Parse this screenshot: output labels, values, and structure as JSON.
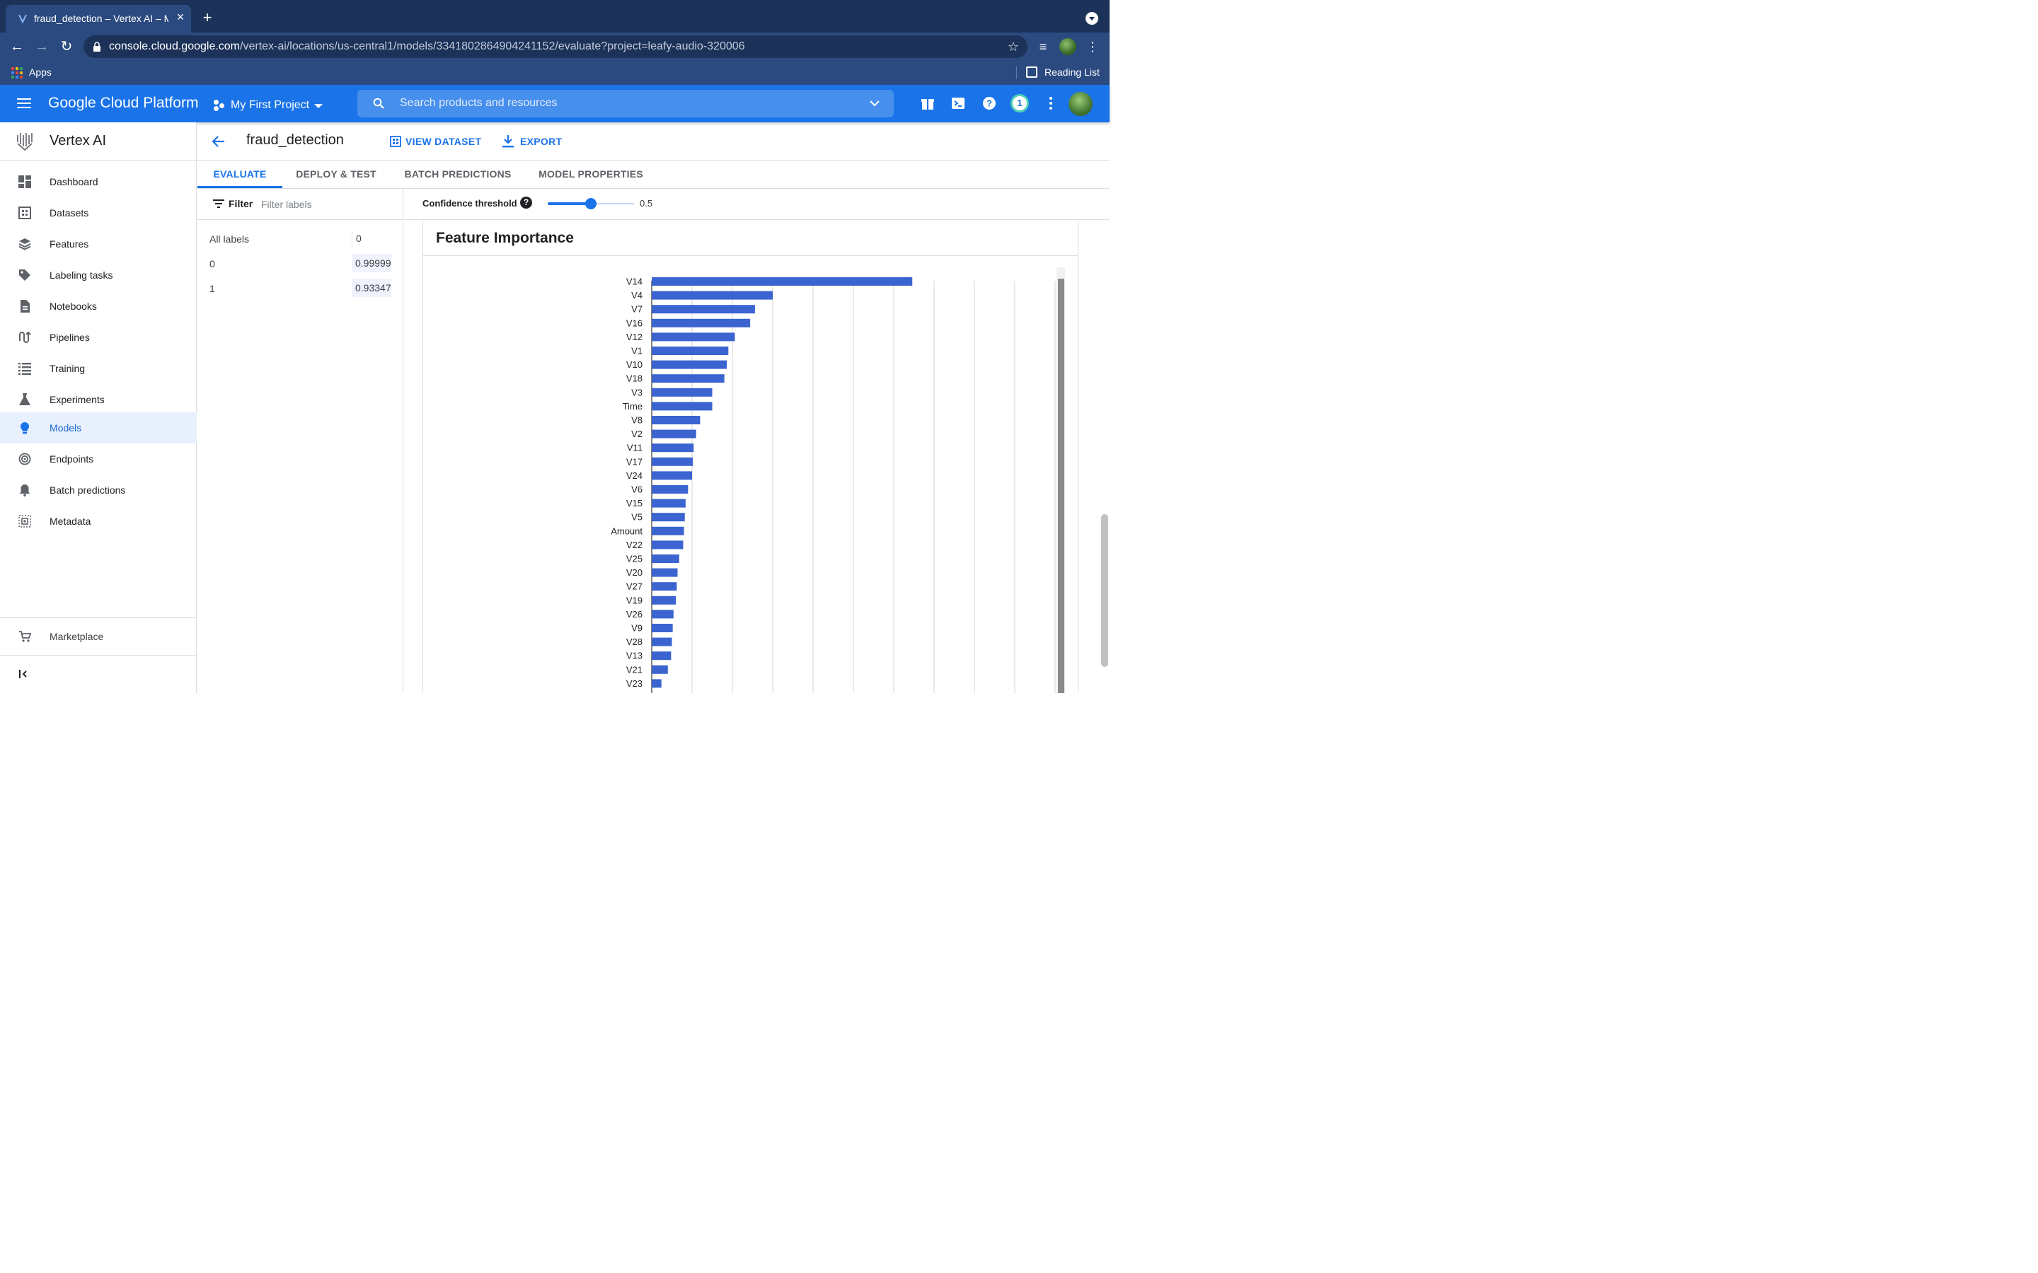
{
  "browser": {
    "tab_title": "fraud_detection – Vertex AI – M",
    "url_host": "console.cloud.google.com",
    "url_path": "/vertex-ai/locations/us-central1/models/3341802864904241152/evaluate?project=leafy-audio-320006",
    "bookmark_apps": "Apps",
    "reading_list": "Reading List"
  },
  "gcp": {
    "title": "Google Cloud Platform",
    "project": "My First Project",
    "search_placeholder": "Search products and resources",
    "notification_count": "1"
  },
  "sidebar": {
    "product": "Vertex AI",
    "items": [
      {
        "label": "Dashboard",
        "icon": "dashboard-icon"
      },
      {
        "label": "Datasets",
        "icon": "datasets-icon"
      },
      {
        "label": "Features",
        "icon": "features-icon"
      },
      {
        "label": "Labeling tasks",
        "icon": "labeling-tag-icon"
      },
      {
        "label": "Notebooks",
        "icon": "notebook-icon"
      },
      {
        "label": "Pipelines",
        "icon": "pipelines-icon"
      },
      {
        "label": "Training",
        "icon": "training-list-icon"
      },
      {
        "label": "Experiments",
        "icon": "flask-icon"
      },
      {
        "label": "Models",
        "icon": "lightbulb-icon",
        "active": true
      },
      {
        "label": "Endpoints",
        "icon": "endpoints-icon"
      },
      {
        "label": "Batch predictions",
        "icon": "bell-icon"
      },
      {
        "label": "Metadata",
        "icon": "metadata-icon"
      }
    ],
    "marketplace": "Marketplace"
  },
  "content": {
    "title": "fraud_detection",
    "view_dataset": "VIEW DATASET",
    "export": "EXPORT",
    "tabs": [
      "EVALUATE",
      "DEPLOY & TEST",
      "BATCH PREDICTIONS",
      "MODEL PROPERTIES"
    ],
    "active_tab": "EVALUATE"
  },
  "filter": {
    "label": "Filter",
    "placeholder": "Filter labels",
    "rows": [
      {
        "name": "All labels",
        "value": "0"
      },
      {
        "name": "0",
        "value": "0.99999"
      },
      {
        "name": "1",
        "value": "0.93347"
      }
    ]
  },
  "threshold": {
    "label": "Confidence threshold",
    "help": "?",
    "value": "0.5",
    "fraction": 0.5
  },
  "chart_data": {
    "type": "bar",
    "orientation": "horizontal",
    "title": "Feature Importance",
    "color": "#3b64d0",
    "categories": [
      "V14",
      "V4",
      "V7",
      "V16",
      "V12",
      "V1",
      "V10",
      "V18",
      "V3",
      "Time",
      "V8",
      "V2",
      "V11",
      "V17",
      "V24",
      "V6",
      "V15",
      "V5",
      "Amount",
      "V22",
      "V25",
      "V20",
      "V27",
      "V19",
      "V26",
      "V9",
      "V28",
      "V13",
      "V21",
      "V23"
    ],
    "values": [
      0.323,
      0.15,
      0.128,
      0.122,
      0.103,
      0.095,
      0.093,
      0.09,
      0.075,
      0.075,
      0.06,
      0.055,
      0.052,
      0.051,
      0.05,
      0.045,
      0.042,
      0.041,
      0.04,
      0.039,
      0.034,
      0.032,
      0.031,
      0.03,
      0.027,
      0.026,
      0.025,
      0.024,
      0.02,
      0.012
    ],
    "xlim": [
      0,
      0.5
    ],
    "grid": true
  }
}
